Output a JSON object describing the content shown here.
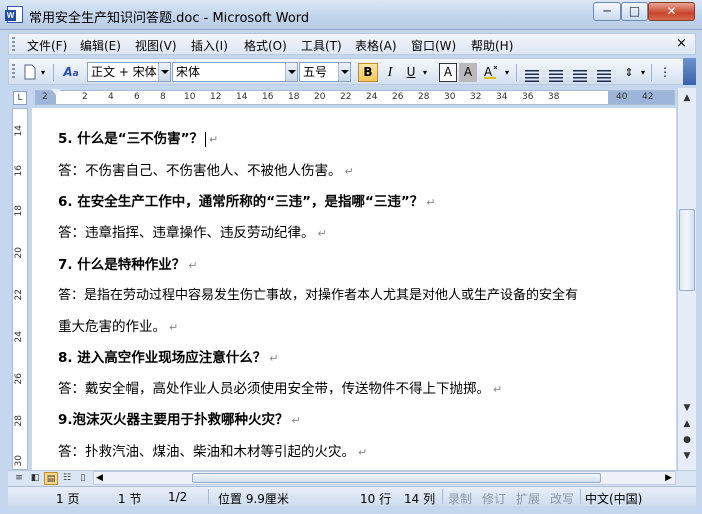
{
  "window": {
    "title": "常用安全生产知识问答题.doc - Microsoft Word",
    "minimize": "─",
    "maximize": "□",
    "close": "✕"
  },
  "menubar": {
    "items": [
      "文件(F)",
      "编辑(E)",
      "视图(V)",
      "插入(I)",
      "格式(O)",
      "工具(T)",
      "表格(A)",
      "窗口(W)",
      "帮助(H)"
    ],
    "close_doc": "×"
  },
  "toolbar": {
    "style_value": "正文 + 宋体",
    "font_value": "宋体",
    "size_value": "五号",
    "bold": "B",
    "italic": "I",
    "underline": "U",
    "char_border": "A",
    "char_shading": "A",
    "highlight": "A"
  },
  "ruler": {
    "tab_selector": "L",
    "ticks": [
      "2",
      "2",
      "4",
      "6",
      "8",
      "10",
      "12",
      "14",
      "16",
      "18",
      "20",
      "22",
      "24",
      "26",
      "28",
      "30",
      "32",
      "34",
      "36",
      "38",
      "40",
      "42"
    ],
    "vticks": [
      "14",
      "16",
      "18",
      "20",
      "22",
      "24",
      "26",
      "28",
      "30"
    ]
  },
  "document": {
    "paragraph_mark": "↵",
    "lines": [
      {
        "text": "5.  什么是“三不伤害”？",
        "bold": true
      },
      {
        "text": "答：不伤害自己、不伤害他人、不被他人伤害。",
        "bold": false
      },
      {
        "text": "6.  在安全生产工作中，通常所称的“三违”，是指哪“三违”？",
        "bold": true
      },
      {
        "text": "答：违章指挥、违章操作、违反劳动纪律。",
        "bold": false
      },
      {
        "text": "7.  什么是特种作业？",
        "bold": true
      },
      {
        "text": "答：是指在劳动过程中容易发生伤亡事故，对操作者本人尤其是对他人或生产设备的安全有",
        "bold": false
      },
      {
        "text": "重大危害的作业。",
        "bold": false
      },
      {
        "text": "8.  进入高空作业现场应注意什么？",
        "bold": true
      },
      {
        "text": "答：戴安全帽，高处作业人员必须使用安全带，传送物件不得上下抛掷。",
        "bold": false
      },
      {
        "text": "9.泡沫灭火器主要用于扑救哪种火灾？",
        "bold": true
      },
      {
        "text": "答：扑救汽油、煤油、柴油和木材等引起的火灾。",
        "bold": false
      }
    ]
  },
  "statusbar": {
    "page": "1 页",
    "section": "1 节",
    "page_of": "1/2",
    "position": "位置 9.9厘米",
    "line": "10 行",
    "column": "14 列",
    "rec": "录制",
    "trk": "修订",
    "ext": "扩展",
    "ovr": "改写",
    "language": "中文(中国)"
  },
  "scrollbar": {
    "up": "▲",
    "down": "▼",
    "prev_page": "▲",
    "select_browse": "●",
    "next_page": "▼",
    "left": "◀",
    "right": "▶"
  }
}
